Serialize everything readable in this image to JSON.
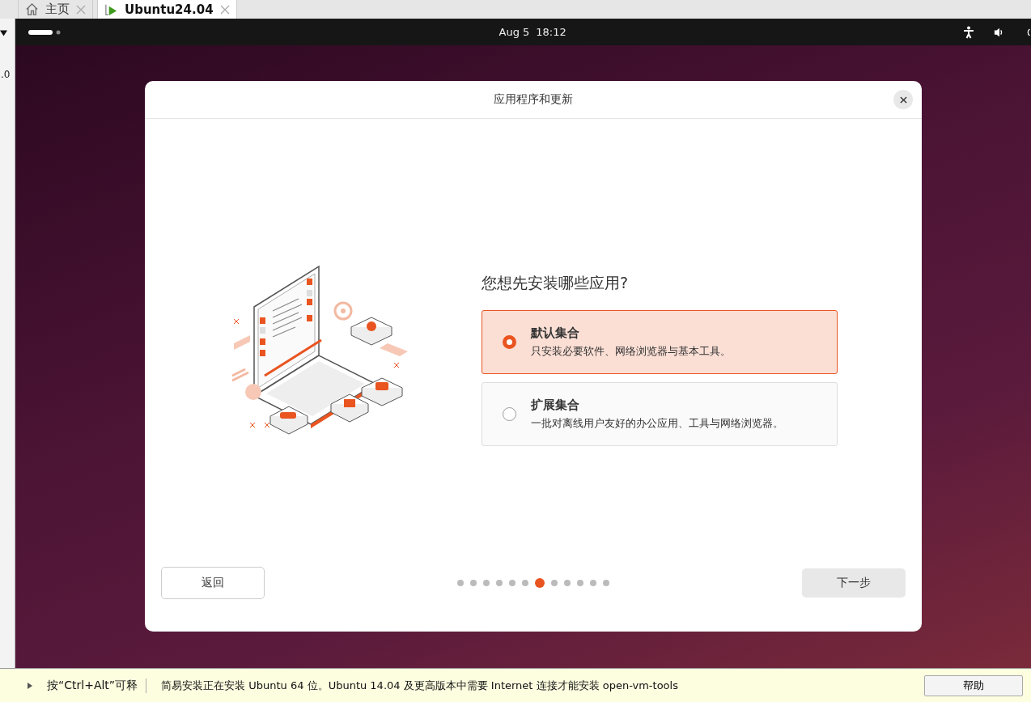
{
  "host_tabs": [
    {
      "label": "主页",
      "kind": "home",
      "selected": false
    },
    {
      "label": "Ubuntu24.04",
      "kind": "vm",
      "selected": true
    }
  ],
  "host_sidebar": {
    "fragment": ".0"
  },
  "top_bar": {
    "date": "Aug 5",
    "time": "18:12"
  },
  "dialog": {
    "title": "应用程序和更新",
    "question": "您想先安装哪些应用?",
    "options": [
      {
        "title": "默认集合",
        "description": "只安装必要软件、网络浏览器与基本工具。",
        "selected": true
      },
      {
        "title": "扩展集合",
        "description": "一批对离线用户友好的办公应用、工具与网络浏览器。",
        "selected": false
      }
    ],
    "back_button": "返回",
    "next_button": "下一步",
    "steps": [
      {
        "selected": false
      },
      {
        "selected": false
      },
      {
        "selected": false
      },
      {
        "selected": false
      },
      {
        "selected": false
      },
      {
        "selected": false
      },
      {
        "selected": true
      },
      {
        "selected": false
      },
      {
        "selected": false
      },
      {
        "selected": false
      },
      {
        "selected": false
      },
      {
        "selected": false
      }
    ]
  },
  "host_status_bar": {
    "hint": "按“Ctrl+Alt”可释",
    "message": "简易安装正在安装 Ubuntu 64 位。Ubuntu 14.04 及更高版本中需要 Internet 连接才能安装 open-vm-tools",
    "help_button": "帮助"
  }
}
